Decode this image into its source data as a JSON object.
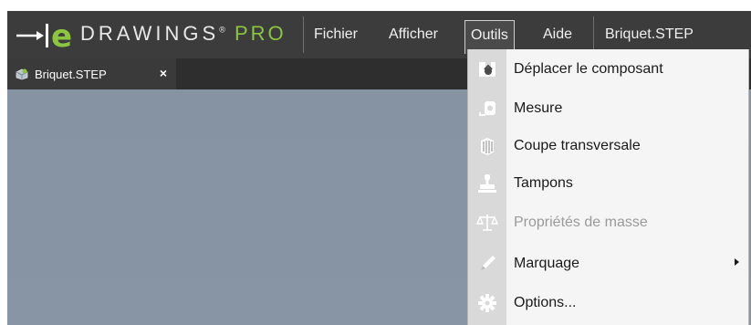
{
  "app": {
    "logo_text": "DRAWINGS",
    "logo_pro": "PRO",
    "logo_reg": "®"
  },
  "menubar": {
    "items": [
      {
        "label": "Fichier"
      },
      {
        "label": "Afficher"
      },
      {
        "label": "Outils"
      },
      {
        "label": "Aide"
      },
      {
        "label": "Briquet.STEP"
      }
    ]
  },
  "tab": {
    "label": "Briquet.STEP",
    "close": "×"
  },
  "dropdown": {
    "items": [
      {
        "label": "Déplacer le composant",
        "icon": "move-component-icon",
        "enabled": true
      },
      {
        "label": "Mesure",
        "icon": "measure-icon",
        "enabled": true
      },
      {
        "label": "Coupe transversale",
        "icon": "section-view-icon",
        "enabled": true
      },
      {
        "label": "Tampons",
        "icon": "stamp-icon",
        "enabled": true
      },
      {
        "label": "Propriétés de masse",
        "icon": "mass-properties-icon",
        "enabled": false
      },
      {
        "label": "Marquage",
        "icon": "pencil-icon",
        "enabled": true,
        "submenu": true
      },
      {
        "label": "Options...",
        "icon": "gear-icon",
        "enabled": true
      }
    ]
  },
  "colors": {
    "titlebar": "#3c3c3c",
    "accent_green": "#8cc63f",
    "viewport": "#8795a4",
    "menu_bg": "#f5f5f5",
    "menu_gutter": "#d9d9d9"
  }
}
